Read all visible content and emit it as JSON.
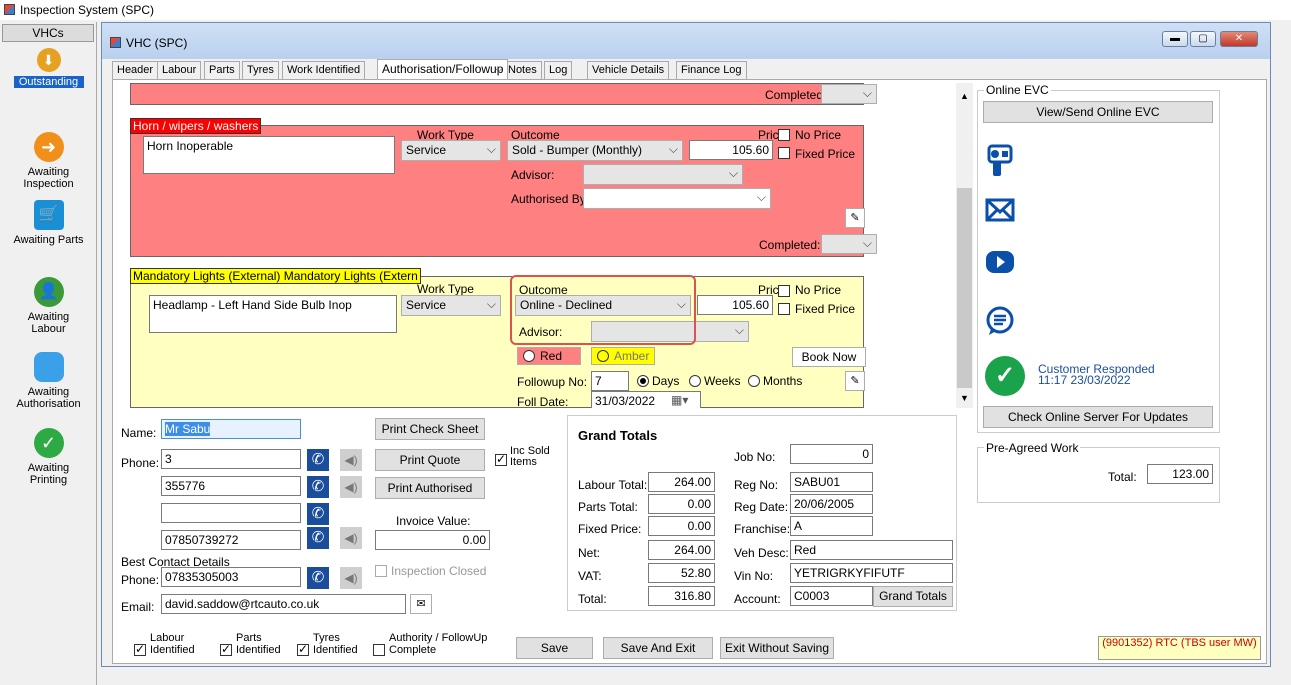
{
  "app": {
    "title": "Inspection System (SPC)"
  },
  "sidebar": {
    "header": "VHCs",
    "items": [
      {
        "label": "Outstanding",
        "color": "#e8a020",
        "icon": "download-arrow-icon",
        "selected": true
      },
      {
        "label": "Awaiting Inspection",
        "color": "#f0901a",
        "icon": "arrow-right-circle-icon"
      },
      {
        "label": "Awaiting Parts",
        "color": "#1a8fd6",
        "icon": "shopping-cart-icon"
      },
      {
        "label": "Awaiting Labour",
        "color": "#3a9a3a",
        "icon": "person-icon"
      },
      {
        "label": "Awaiting Authorisation",
        "color": "#3aa0e8",
        "icon": "speech-bubble-icon"
      },
      {
        "label": "Awaiting Printing",
        "color": "#2eaa44",
        "icon": "check-circle-icon"
      }
    ]
  },
  "window": {
    "title": "VHC (SPC)",
    "tabs": [
      "Header",
      "Labour",
      "Parts",
      "Tyres",
      "Work Identified",
      "Authorisation/Followup",
      "Notes",
      "Log",
      "Vehicle Details",
      "Finance Log"
    ],
    "selected_tab": "Authorisation/Followup"
  },
  "items": {
    "top": {
      "completed_label": "Completed:"
    },
    "horn": {
      "title": "Horn / wipers / washers",
      "description": "Horn Inoperable",
      "work_type_label": "Work Type",
      "work_type": "Service",
      "outcome_label": "Outcome",
      "outcome": "Sold - Bumper (Monthly)",
      "price_label": "Price",
      "price": "105.60",
      "no_price_label": "No Price",
      "fixed_price_label": "Fixed Price",
      "advisor_label": "Advisor:",
      "authorised_by_label": "Authorised By",
      "completed_label": "Completed:"
    },
    "lights": {
      "title": "Mandatory Lights (External) Mandatory Lights (Extern",
      "description": "Headlamp - Left Hand Side Bulb Inop",
      "work_type_label": "Work Type",
      "work_type": "Service",
      "outcome_label": "Outcome",
      "outcome": "Online - Declined",
      "price_label": "Price",
      "price": "105.60",
      "no_price_label": "No Price",
      "fixed_price_label": "Fixed Price",
      "advisor_label": "Advisor:",
      "red_label": "Red",
      "amber_label": "Amber",
      "book_now_label": "Book Now",
      "followup_label": "Followup No:",
      "followup_no": "7",
      "days_label": "Days",
      "weeks_label": "Weeks",
      "months_label": "Months",
      "foll_date_label": "Foll Date:",
      "foll_date": "31/03/2022"
    }
  },
  "customer": {
    "name_label": "Name:",
    "name": "Mr Sabu",
    "phone_label": "Phone:",
    "phones": [
      "3",
      "355776",
      "",
      "07850739272"
    ],
    "best_contact_label": "Best Contact Details",
    "best_phone_label": "Phone:",
    "best_phone": "07835305003",
    "email_label": "Email:",
    "email": "david.saddow@rtcauto.co.uk"
  },
  "actions": {
    "print_check_sheet": "Print Check Sheet",
    "print_quote": "Print Quote",
    "inc_sold_items": "Inc Sold Items",
    "print_authorised": "Print Authorised",
    "invoice_value_label": "Invoice Value:",
    "invoice_value": "0.00",
    "inspection_closed": "Inspection Closed"
  },
  "totals": {
    "title": "Grand Totals",
    "labour_total_label": "Labour Total:",
    "labour_total": "264.00",
    "parts_total_label": "Parts Total:",
    "parts_total": "0.00",
    "fixed_price_label": "Fixed Price:",
    "fixed_price": "0.00",
    "net_label": "Net:",
    "net": "264.00",
    "vat_label": "VAT:",
    "vat": "52.80",
    "total_label": "Total:",
    "total": "316.80",
    "job_no_label": "Job No:",
    "job_no": "0",
    "reg_no_label": "Reg No:",
    "reg_no": "SABU01",
    "reg_date_label": "Reg Date:",
    "reg_date": "20/06/2005",
    "franchise_label": "Franchise:",
    "franchise": "A",
    "veh_desc_label": "Veh Desc:",
    "veh_desc": "Red",
    "vin_label": "Vin No:",
    "vin": "YETRIGRKYFIFUTF",
    "account_label": "Account:",
    "account": "C0003",
    "grand_totals_btn": "Grand Totals"
  },
  "online_evc": {
    "group_label": "Online EVC",
    "view_send": "View/Send Online EVC",
    "customer_responded": "Customer Responded",
    "responded_time": "11:17 23/03/2022",
    "check_server": "Check Online Server For Updates"
  },
  "pre_agreed": {
    "group_label": "Pre-Agreed Work",
    "total_label": "Total:",
    "total": "123.00"
  },
  "footer": {
    "labour_identified": "Labour Identified",
    "parts_identified": "Parts Identified",
    "tyres_identified": "Tyres Identified",
    "authority_complete": "Authority / FollowUp Complete",
    "save": "Save",
    "save_exit": "Save And Exit",
    "exit_without_saving": "Exit Without Saving",
    "status": "(9901352) RTC (TBS user MW)"
  },
  "colors": {
    "red_item": "#ff8080",
    "yellow_item": "#ffffc0",
    "highlight": "#d9534f",
    "status_text": "#d00000"
  }
}
